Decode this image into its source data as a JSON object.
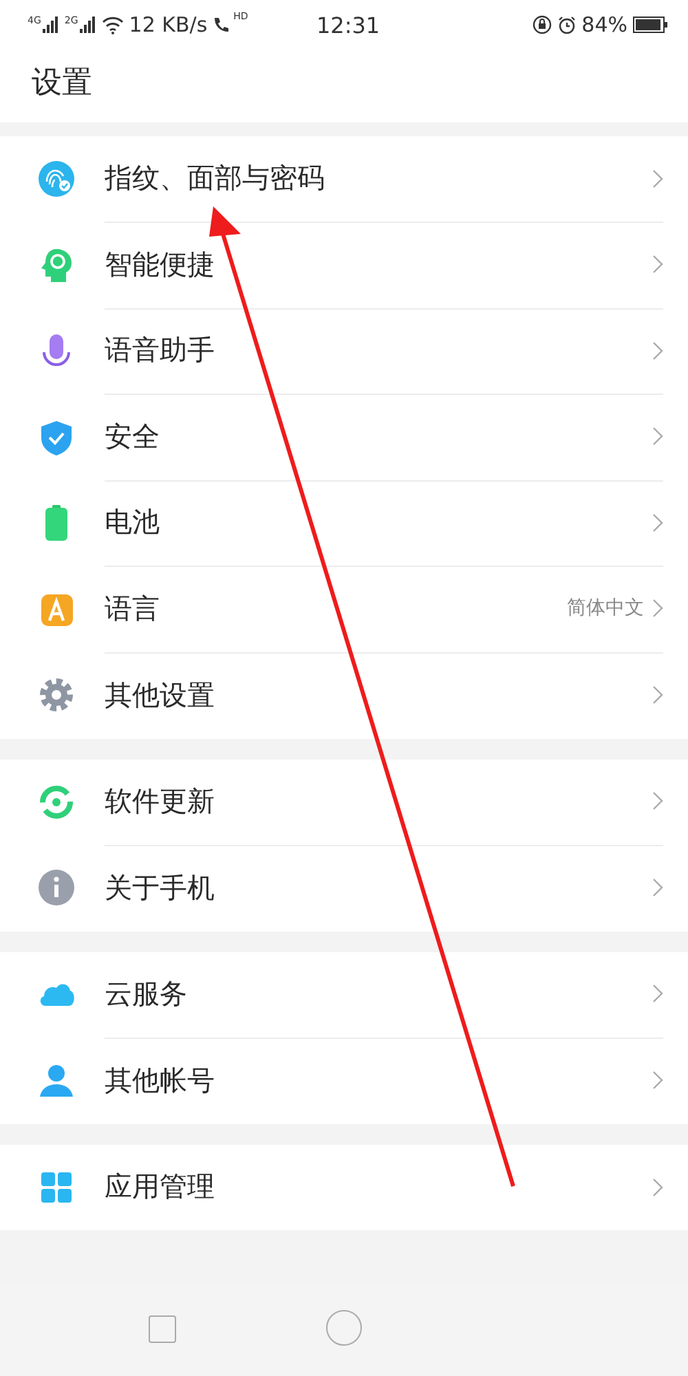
{
  "status_bar": {
    "sim1": "4G",
    "sim2": "2G",
    "speed": "12 KB/s",
    "call": "HD",
    "time": "12:31",
    "battery": "84%"
  },
  "title": "设置",
  "groups": [
    {
      "items": [
        {
          "label": "指纹、面部与密码"
        },
        {
          "label": "智能便捷"
        },
        {
          "label": "语音助手"
        },
        {
          "label": "安全"
        },
        {
          "label": "电池"
        },
        {
          "label": "语言",
          "value": "简体中文"
        },
        {
          "label": "其他设置"
        }
      ]
    },
    {
      "items": [
        {
          "label": "软件更新"
        },
        {
          "label": "关于手机"
        }
      ]
    },
    {
      "items": [
        {
          "label": "云服务"
        },
        {
          "label": "其他帐号"
        }
      ]
    },
    {
      "items": [
        {
          "label": "应用管理"
        }
      ]
    }
  ]
}
